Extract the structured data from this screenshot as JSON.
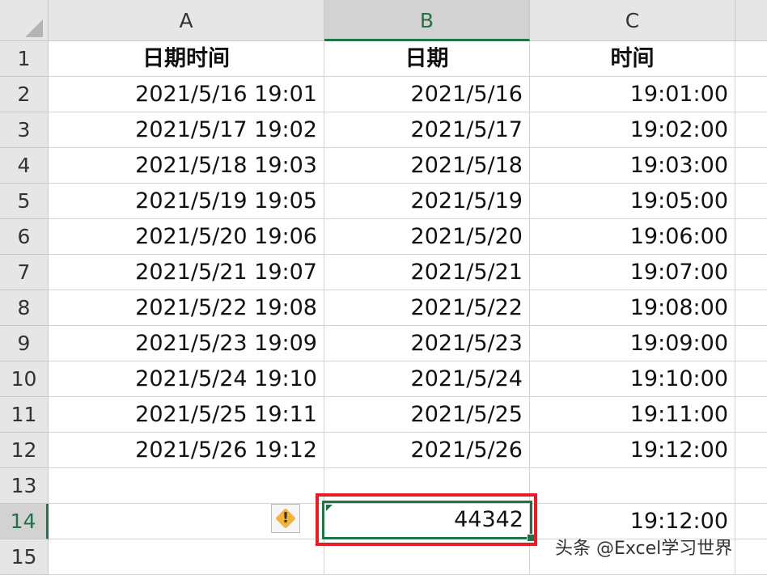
{
  "columns": [
    "A",
    "B",
    "C"
  ],
  "header_row": {
    "a": "日期时间",
    "b": "日期",
    "c": "时间"
  },
  "rows": [
    {
      "num": "2",
      "a": "2021/5/16 19:01",
      "b": "2021/5/16",
      "c": "19:01:00"
    },
    {
      "num": "3",
      "a": "2021/5/17 19:02",
      "b": "2021/5/17",
      "c": "19:02:00"
    },
    {
      "num": "4",
      "a": "2021/5/18 19:03",
      "b": "2021/5/18",
      "c": "19:03:00"
    },
    {
      "num": "5",
      "a": "2021/5/19 19:05",
      "b": "2021/5/19",
      "c": "19:05:00"
    },
    {
      "num": "6",
      "a": "2021/5/20 19:06",
      "b": "2021/5/20",
      "c": "19:06:00"
    },
    {
      "num": "7",
      "a": "2021/5/21 19:07",
      "b": "2021/5/21",
      "c": "19:07:00"
    },
    {
      "num": "8",
      "a": "2021/5/22 19:08",
      "b": "2021/5/22",
      "c": "19:08:00"
    },
    {
      "num": "9",
      "a": "2021/5/23 19:09",
      "b": "2021/5/23",
      "c": "19:09:00"
    },
    {
      "num": "10",
      "a": "2021/5/24 19:10",
      "b": "2021/5/24",
      "c": "19:10:00"
    },
    {
      "num": "11",
      "a": "2021/5/25 19:11",
      "b": "2021/5/25",
      "c": "19:11:00"
    },
    {
      "num": "12",
      "a": "2021/5/26 19:12",
      "b": "2021/5/26",
      "c": "19:12:00"
    }
  ],
  "row_numbers": {
    "r1": "1",
    "r13": "13",
    "r14": "14",
    "r15": "15"
  },
  "row14": {
    "b": "44342",
    "c": "19:12:00"
  },
  "warning_button": {
    "icon": "warning-diamond-icon",
    "glyph": "!"
  },
  "selected_column": "B",
  "selected_row": "14",
  "watermark": "头条 @Excel学习世界",
  "colors": {
    "selection": "#217346",
    "highlight_frame": "#e21f26",
    "warning": "#f2b33d"
  }
}
